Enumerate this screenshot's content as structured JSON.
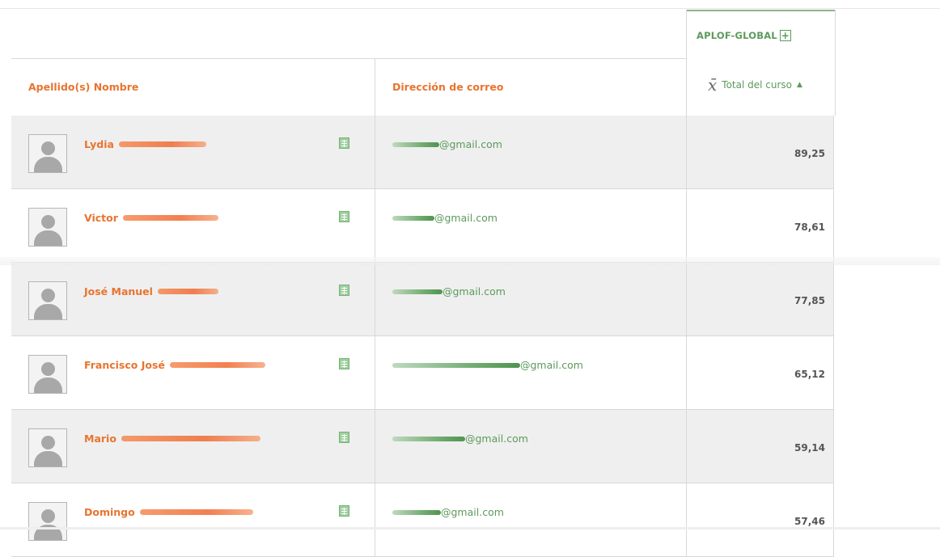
{
  "group_header": {
    "label": "APLOF-GLOBAL",
    "expand_icon": "plus-box-icon"
  },
  "columns": {
    "name": "Apellido(s) Nombre",
    "email": "Dirección de correo",
    "total_symbol": "x̄",
    "total": "Total del curso",
    "sort_icon": "sort-ascending-icon"
  },
  "colors": {
    "accent_orange": "#e8742f",
    "accent_green": "#5c9a5c"
  },
  "rows": [
    {
      "first_name": "Lydia",
      "email_domain": "@gmail.com",
      "total": "89,25"
    },
    {
      "first_name": "Victor",
      "email_domain": "@gmail.com",
      "total": "78,61"
    },
    {
      "first_name": "José Manuel",
      "email_domain": "@gmail.com",
      "total": "77,85"
    },
    {
      "first_name": "Francisco José",
      "email_domain": "@gmail.com",
      "total": "65,12"
    },
    {
      "first_name": "Mario",
      "email_domain": "@gmail.com",
      "total": "59,14"
    },
    {
      "first_name": "Domingo",
      "email_domain": "@gmail.com",
      "total": "57,46"
    }
  ]
}
